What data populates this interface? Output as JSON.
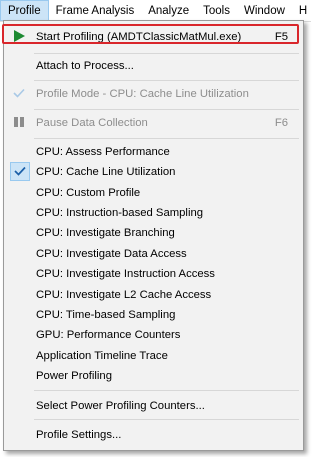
{
  "menubar": {
    "items": [
      "Profile",
      "Frame Analysis",
      "Analyze",
      "Tools",
      "Window",
      "H"
    ]
  },
  "colors": {
    "highlight_border": "#d9262b",
    "check_bg": "#cce4f7",
    "play_icon": "#1e8a32"
  },
  "menu": {
    "start_profiling": {
      "label": "Start Profiling (AMDTClassicMatMul.exe)",
      "shortcut": "F5",
      "icon": "play-icon"
    },
    "attach": {
      "label": "Attach to Process..."
    },
    "profile_mode": {
      "label": "Profile Mode - CPU: Cache Line Utilization",
      "icon": "check-icon"
    },
    "pause": {
      "label": "Pause Data Collection",
      "shortcut": "F6",
      "icon": "pause-icon"
    },
    "modes": [
      {
        "label": "CPU: Assess Performance"
      },
      {
        "label": "CPU: Cache Line Utilization",
        "checked": true
      },
      {
        "label": "CPU: Custom Profile"
      },
      {
        "label": "CPU: Instruction-based Sampling"
      },
      {
        "label": "CPU: Investigate Branching"
      },
      {
        "label": "CPU: Investigate Data Access"
      },
      {
        "label": "CPU: Investigate Instruction Access"
      },
      {
        "label": "CPU: Investigate L2 Cache Access"
      },
      {
        "label": "CPU: Time-based Sampling"
      },
      {
        "label": "GPU: Performance Counters"
      },
      {
        "label": "Application Timeline Trace"
      },
      {
        "label": "Power Profiling"
      }
    ],
    "select_power": {
      "label": "Select Power Profiling Counters..."
    },
    "settings": {
      "label": "Profile Settings..."
    }
  }
}
